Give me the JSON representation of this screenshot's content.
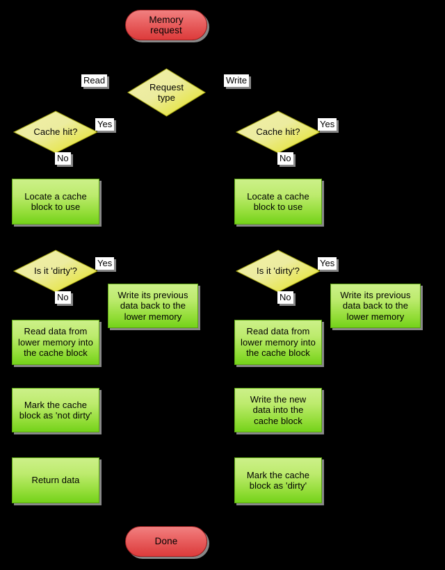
{
  "diagram": {
    "title": "Cache memory request flowchart",
    "background_color": "#000000",
    "colors": {
      "terminal_fill": "#e14b4b",
      "terminal_stroke": "#a02020",
      "process_fill": "#93dd38",
      "process_stroke": "#5aa50f",
      "decision_fill": "#e8e63c",
      "decision_stroke": "#a8a810",
      "edge_stroke": "#000000",
      "label_fill": "#ffffff",
      "label_text": "#000000",
      "shadow": "#999999"
    }
  },
  "nodes": {
    "start": {
      "label": "Memory\nrequest",
      "type": "terminal"
    },
    "request_type": {
      "label": "Request\ntype",
      "type": "decision"
    },
    "read_cache_hit": {
      "label": "Cache hit?",
      "type": "decision"
    },
    "read_locate_block": {
      "label": "Locate a cache\nblock to use",
      "type": "process"
    },
    "read_is_dirty": {
      "label": "Is it 'dirty'?",
      "type": "decision"
    },
    "read_writeback": {
      "label": "Write its previous\ndata back to the\nlower memory",
      "type": "process"
    },
    "read_fill_block": {
      "label": "Read data from\nlower memory into\nthe cache block",
      "type": "process"
    },
    "read_mark_not_dirty": {
      "label": "Mark the cache\nblock as 'not dirty'",
      "type": "process"
    },
    "read_return_data": {
      "label": "Return data",
      "type": "process"
    },
    "write_cache_hit": {
      "label": "Cache hit?",
      "type": "decision"
    },
    "write_locate_block": {
      "label": "Locate a cache\nblock to use",
      "type": "process"
    },
    "write_is_dirty": {
      "label": "Is it 'dirty'?",
      "type": "decision"
    },
    "write_writeback": {
      "label": "Write its previous\ndata back to the\nlower memory",
      "type": "process"
    },
    "write_fill_block": {
      "label": "Read data from\nlower memory into\nthe cache block",
      "type": "process"
    },
    "write_store_data": {
      "label": "Write the new\ndata into the\ncache block",
      "type": "process"
    },
    "write_mark_dirty": {
      "label": "Mark the cache\nblock as 'dirty'",
      "type": "process"
    },
    "done": {
      "label": "Done",
      "type": "terminal"
    }
  },
  "edge_labels": {
    "read_branch": "Read",
    "write_branch": "Write",
    "read_hit_yes": "Yes",
    "read_hit_no": "No",
    "read_dirty_yes": "Yes",
    "read_dirty_no": "No",
    "write_hit_yes": "Yes",
    "write_hit_no": "No",
    "write_dirty_yes": "Yes",
    "write_dirty_no": "No"
  },
  "edges": [
    {
      "from": "start",
      "to": "request_type",
      "label": ""
    },
    {
      "from": "request_type",
      "to": "read_cache_hit",
      "label": "Read"
    },
    {
      "from": "request_type",
      "to": "write_cache_hit",
      "label": "Write"
    },
    {
      "from": "read_cache_hit",
      "to": "read_return_data",
      "label": "Yes"
    },
    {
      "from": "read_cache_hit",
      "to": "read_locate_block",
      "label": "No"
    },
    {
      "from": "read_locate_block",
      "to": "read_is_dirty",
      "label": ""
    },
    {
      "from": "read_is_dirty",
      "to": "read_writeback",
      "label": "Yes"
    },
    {
      "from": "read_is_dirty",
      "to": "read_fill_block",
      "label": "No"
    },
    {
      "from": "read_writeback",
      "to": "read_fill_block",
      "label": ""
    },
    {
      "from": "read_fill_block",
      "to": "read_mark_not_dirty",
      "label": ""
    },
    {
      "from": "read_mark_not_dirty",
      "to": "read_return_data",
      "label": ""
    },
    {
      "from": "read_return_data",
      "to": "done",
      "label": ""
    },
    {
      "from": "write_cache_hit",
      "to": "write_store_data",
      "label": "Yes"
    },
    {
      "from": "write_cache_hit",
      "to": "write_locate_block",
      "label": "No"
    },
    {
      "from": "write_locate_block",
      "to": "write_is_dirty",
      "label": ""
    },
    {
      "from": "write_is_dirty",
      "to": "write_writeback",
      "label": "Yes"
    },
    {
      "from": "write_is_dirty",
      "to": "write_fill_block",
      "label": "No"
    },
    {
      "from": "write_writeback",
      "to": "write_fill_block",
      "label": ""
    },
    {
      "from": "write_fill_block",
      "to": "write_store_data",
      "label": ""
    },
    {
      "from": "write_store_data",
      "to": "write_mark_dirty",
      "label": ""
    },
    {
      "from": "write_mark_dirty",
      "to": "done",
      "label": ""
    }
  ]
}
